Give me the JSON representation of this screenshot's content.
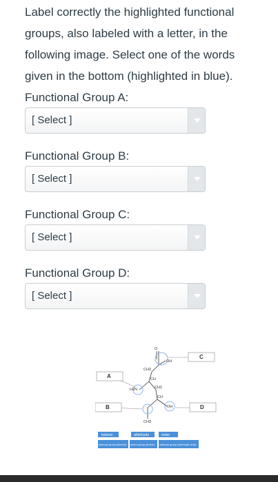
{
  "question": {
    "line1": "Label correctly the highlighted functional",
    "line2": "groups, also labeled with a letter, in the",
    "line3": "following image. Select one of the words",
    "line4": "given in the bottom (highlighted in blue)."
  },
  "groups": [
    {
      "label": "Functional Group A:",
      "value": "[ Select ]"
    },
    {
      "label": "Functional Group B:",
      "value": "[ Select ]"
    },
    {
      "label": "Functional Group C:",
      "value": "[ Select ]"
    },
    {
      "label": "Functional Group D:",
      "value": "[ Select ]"
    }
  ],
  "diagram": {
    "letters": {
      "a": "A",
      "b": "B",
      "c": "C",
      "d": "D"
    },
    "atoms": {
      "o": "O",
      "oh1": "OH",
      "ch2a": "CH2",
      "h2n": "H2N",
      "ch": "CH",
      "ch2b": "CH2",
      "ch_2": "CH",
      "oh2": "OH",
      "ch3": "CH3"
    },
    "options": {
      "row1": [
        "ketone",
        "aldehyde",
        "ester"
      ],
      "row2": [
        "hydroxyl group (alcohol)",
        "amino group (amine)",
        "carboxyl group (carboxylic acid)"
      ]
    },
    "colors": {
      "highlight": "#4a90d9",
      "box": "#e6e6e6"
    }
  }
}
